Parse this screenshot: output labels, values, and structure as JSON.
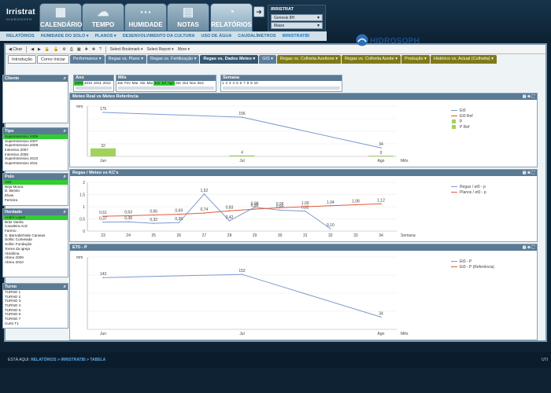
{
  "app": {
    "logo": "Irristrat",
    "logo_sub": "HIDROSOPH"
  },
  "nav": [
    {
      "label": "CALENDÁRIO",
      "icon": "calendar-icon",
      "glyph": "▦"
    },
    {
      "label": "TEMPO",
      "icon": "weather-icon",
      "glyph": "☁"
    },
    {
      "label": "HUMIDADE",
      "icon": "moisture-icon",
      "glyph": "⋯"
    },
    {
      "label": "NOTAS",
      "icon": "notes-icon",
      "glyph": "▤"
    },
    {
      "label": "RELATÓRIOS",
      "icon": "reports-icon",
      "glyph": "◔"
    }
  ],
  "user": {
    "title": "IRRISTRAT",
    "select1": "Genesis 8H",
    "select2": "Maize"
  },
  "subnav": [
    "RELATÓRIOS",
    "HUMIDADE DO SOLO ▾",
    "PLANOS ▾",
    "DESENVOLVIMENTO DA CULTURA",
    "USO DE ÁGUA",
    "CAUDALÍMETROS",
    "IRRISTRATBI"
  ],
  "toolbar": {
    "clear": "Clear",
    "bookmark": "Select Bookmark",
    "report": "Select Report",
    "more": "More"
  },
  "tabs": [
    {
      "label": "Introdução",
      "style": "t-white"
    },
    {
      "label": "Como Iniciar",
      "style": "t-white"
    },
    {
      "label": "Performance ▾",
      "style": "t-blue"
    },
    {
      "label": "Regas vs. Plano ▾",
      "style": "t-blue"
    },
    {
      "label": "Regas vs. Fertilização ▾",
      "style": "t-blue"
    },
    {
      "label": "Regas vs. Dados Meteo ▾",
      "style": "t-blueact"
    },
    {
      "label": "GIS ▾",
      "style": "t-blue"
    },
    {
      "label": "Regas vs. Colheita Azeitone ▾",
      "style": "t-green"
    },
    {
      "label": "Regas vs. Colheita Azeite ▾",
      "style": "t-green"
    },
    {
      "label": "Produção ▾",
      "style": "t-green"
    },
    {
      "label": "Histórico vs. Actual (Colheita) ▾",
      "style": "t-green"
    }
  ],
  "filters": {
    "ano": {
      "title": "Ano",
      "items": [
        "2009",
        "2010",
        "2011",
        "2012"
      ],
      "selected": [
        0
      ]
    },
    "mes": {
      "title": "Mês",
      "items": [
        "Jan",
        "Fev",
        "Mar",
        "Abr",
        "Mai",
        "Jun",
        "Jul",
        "Ago",
        "Set",
        "Out",
        "Nov",
        "Dez"
      ],
      "selected": [
        5,
        6,
        7
      ]
    },
    "semana": {
      "title": "Semana",
      "items": [
        "1",
        "2",
        "3",
        "4",
        "5",
        "6",
        "7",
        "8",
        "9",
        "10"
      ],
      "selected": []
    }
  },
  "panels": {
    "cliente": {
      "title": "Cliente",
      "items": []
    },
    "tipo": {
      "title": "Tipo",
      "items": [
        "SuperIntensivo 2009",
        "SuperIntensivo 2007",
        "SuperIntensivo 2009",
        "Intensivo 2007",
        "Intensivo 2008",
        "SuperIntensivo 2010",
        "SuperIntensivo 2011"
      ],
      "selected": [
        0
      ]
    },
    "polo": {
      "title": "Polo",
      "items": [
        "Aviz",
        "Beja Moura",
        "D. Benito",
        "Elvas",
        "Ferreira"
      ],
      "selected": [
        0
      ]
    },
    "herdade": {
      "title": "Herdade",
      "items": [
        "André Lopes",
        "Brás Varela",
        "Cavaleira Aviz",
        "Farrino",
        "S. Barnabé/Vale Caneias",
        "Sofisc Cumieada",
        "Sofisc Fundação",
        "Torres da Igreja",
        "Abrafima",
        "Abreu 2009",
        "Abreu 2010"
      ],
      "selected": [
        0
      ]
    },
    "turno": {
      "title": "Turno",
      "items": [
        "TURNO 1",
        "TURNO 2",
        "TURNO 3",
        "TURNO 4",
        "TURNO 5",
        "TURNO 6",
        "TURNO 7",
        "Curto T1"
      ],
      "selected": []
    }
  },
  "brand": {
    "name": "HIDROSOPH"
  },
  "charts": {
    "meteo": {
      "title": "Meteo Real vs Meteo Referência",
      "yunit": "mm",
      "xlabel": "Mês",
      "legend": [
        "Et0",
        "Et0 Ref",
        "P",
        "P Ref"
      ]
    },
    "regas": {
      "title": "Regas / Meteo vs KC's",
      "xlabel": "Semana",
      "legend": [
        "Regas / et0 - p",
        "Planos / et0 - p"
      ]
    },
    "eto": {
      "title": "ET0 - P",
      "yunit": "mm",
      "xlabel": "Mês",
      "legend": [
        "Et0 - P",
        "Et0 - P (Referência)"
      ]
    }
  },
  "chart_data": [
    {
      "type": "line",
      "title": "Meteo Real vs Meteo Referência",
      "ylabel": "mm",
      "xlabel": "Mês",
      "categories": [
        "Jun",
        "Jul",
        "Ago"
      ],
      "series": [
        {
          "name": "Et0",
          "values": [
            175,
            156,
            34
          ]
        },
        {
          "name": "P",
          "values": [
            32,
            4,
            0
          ]
        }
      ],
      "ylim": [
        0,
        200
      ],
      "legend": "right"
    },
    {
      "type": "line",
      "title": "Regas / Meteo vs KC's",
      "xlabel": "Semana",
      "categories": [
        23,
        24,
        25,
        26,
        27,
        28,
        29,
        30,
        31,
        32,
        33,
        34
      ],
      "series": [
        {
          "name": "Regas / et0 - p",
          "values": [
            0.37,
            0.38,
            0.32,
            0.35,
            1.52,
            0.42,
            0.98,
            0.86,
            0.82,
            0.1,
            null,
            null
          ]
        },
        {
          "name": "Planos / et0 - p",
          "values": [
            0.61,
            0.63,
            0.66,
            0.69,
            0.74,
            0.83,
            0.9,
            0.96,
            1.0,
            1.04,
            1.08,
            1.12
          ]
        }
      ],
      "ylim": [
        0,
        2
      ],
      "legend": "right"
    },
    {
      "type": "line",
      "title": "ET0 - P",
      "ylabel": "mm",
      "xlabel": "Mês",
      "categories": [
        "Jun",
        "Jul",
        "Ago"
      ],
      "series": [
        {
          "name": "Et0 - P",
          "values": [
            143,
            152,
            34
          ]
        }
      ],
      "ylim": [
        0,
        200
      ],
      "legend": "right"
    }
  ],
  "footer": {
    "prefix": "ESTÁ AQUI:",
    "c1": "RELATÓRIOS",
    "c2": "IRRISTRATBI",
    "c3": "TABELA",
    "right": "UTI"
  }
}
